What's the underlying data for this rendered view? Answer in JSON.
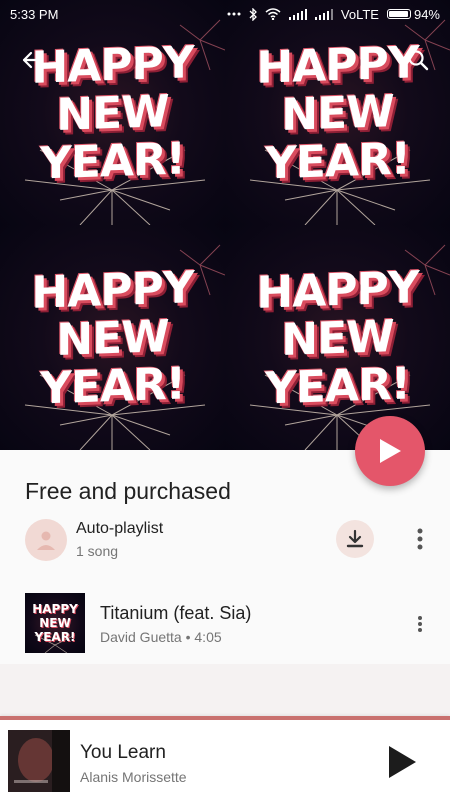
{
  "status_bar": {
    "time": "5:33 PM",
    "network": "VoLTE",
    "battery_percent": "94%",
    "battery_level": 0.94
  },
  "header": {
    "art_text_lines": [
      "HAPPY",
      "NEW",
      "YEAR!"
    ]
  },
  "playlist": {
    "section_title": "Free and purchased",
    "auto_playlist_title": "Auto-playlist",
    "auto_playlist_count": "1 song"
  },
  "tracks": [
    {
      "title": "Titanium (feat. Sia)",
      "meta": "David Guetta • 4:05",
      "thumb_text_lines": [
        "HAPPY",
        "NEW",
        "YEAR!"
      ]
    }
  ],
  "now_playing": {
    "title": "You Learn",
    "artist": "Alanis Morissette",
    "progress": 1.0
  },
  "colors": {
    "accent": "#e4566a",
    "progress": "#c9716f",
    "avatar_bg": "#f1d9d4"
  },
  "icons": {
    "back": "arrow-back-icon",
    "search": "search-icon",
    "play_fab": "play-icon",
    "download": "download-icon",
    "more": "more-vert-icon",
    "np_play": "play-icon"
  }
}
